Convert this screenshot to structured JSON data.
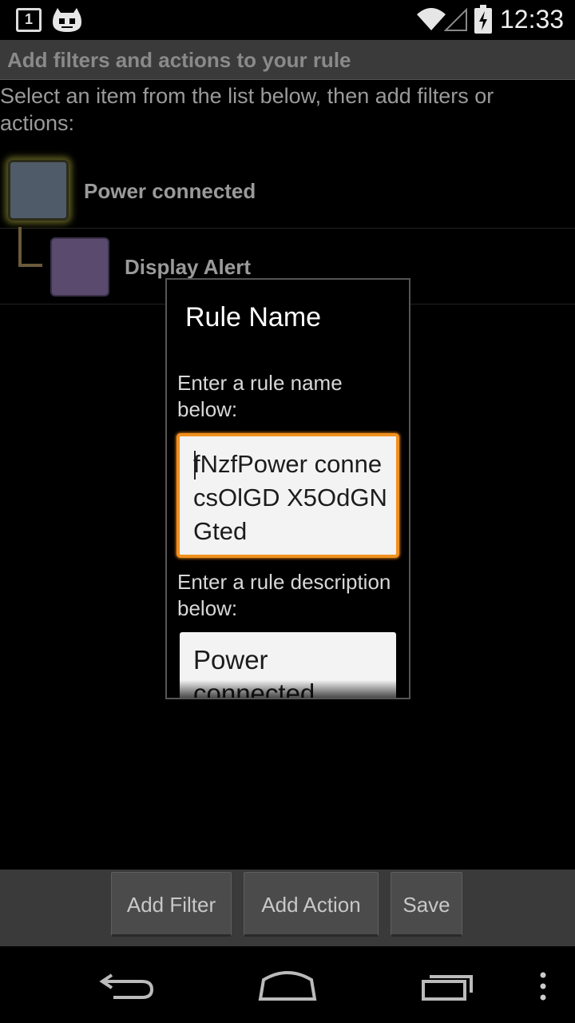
{
  "status_bar": {
    "notification_count": "1",
    "time": "12:33",
    "icons": [
      "notification-count-icon",
      "cyanogenmod-icon",
      "wifi-icon",
      "signal-icon",
      "battery-charging-icon"
    ]
  },
  "header": {
    "title": "Add filters and actions to your rule"
  },
  "instruction": "Select an item from the list below, then add filters or actions:",
  "rule_items": [
    {
      "label": "Power connected",
      "color": "#4f5b69"
    },
    {
      "label": "Display Alert",
      "color": "#5a4a6e"
    }
  ],
  "dialog": {
    "title": "Rule Name",
    "name_prompt": "Enter a rule name below:",
    "name_value": "fNzfPower connecsOlGD X5OdGNGted",
    "description_prompt": "Enter a rule description below:",
    "description_value": "Power connected",
    "accent_color": "#f0901e"
  },
  "buttons": {
    "add_filter": "Add Filter",
    "add_action": "Add Action",
    "save": "Save"
  },
  "nav_bar": {
    "icons": [
      "back-icon",
      "home-icon",
      "recents-icon",
      "overflow-menu-icon"
    ]
  }
}
